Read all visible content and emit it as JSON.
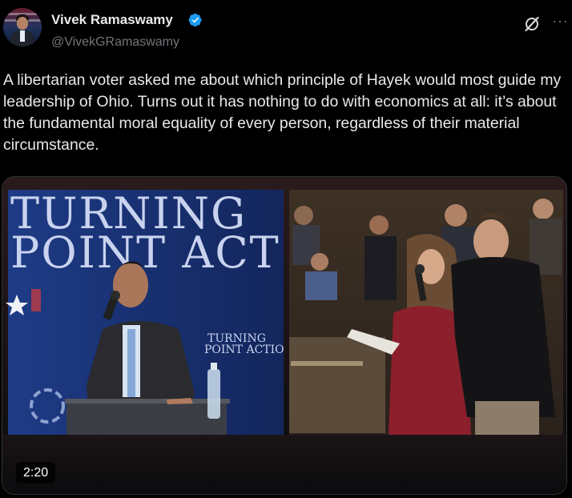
{
  "author": {
    "display_name": "Vivek Ramaswamy",
    "handle": "@VivekGRamaswamy",
    "verified_icon": "verified-badge-icon"
  },
  "actions": {
    "grok_icon": "grok-icon",
    "more_label": "···"
  },
  "tweet": {
    "text": "A libertarian voter asked me about which principle of Hayek would most guide my leadership of Ohio. Turns out it has nothing to do with economics at all: it’s about the fundamental moral equality of every person, regardless of their material circumstance."
  },
  "media": {
    "banner_line1": "TURNING",
    "banner_line2": "POINT ACT",
    "podium_line1": "TURNING",
    "podium_line2": "POINT ACTIO",
    "duration": "2:20"
  },
  "colors": {
    "background": "#000000",
    "text": "#e7e9ea",
    "muted": "#71767b",
    "verified_blue": "#1d9bf0",
    "banner_blue": "#233f87"
  }
}
